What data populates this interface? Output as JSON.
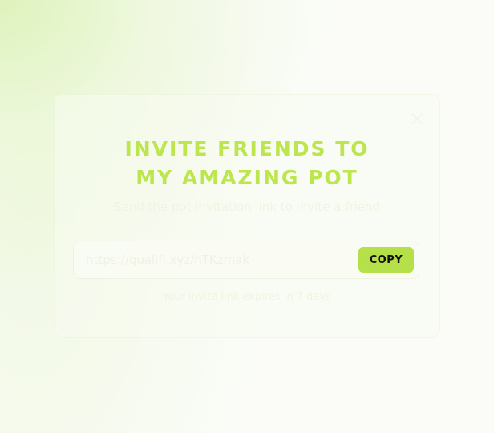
{
  "modal": {
    "title_line1": "INVITE FRIENDS TO",
    "title_line2": "MY AMAZING POT",
    "subtitle": "Send the pot invitation link to invite a friend",
    "invite_link": "https://qualifi.xyz/hTKzmak",
    "copy_label": "COPY",
    "expiry_note": "Your invite link expires in 7 days",
    "close_icon": "close-icon"
  },
  "colors": {
    "accent": "#b6e049",
    "title": "#bce54e",
    "background": "#fbfcf8"
  }
}
